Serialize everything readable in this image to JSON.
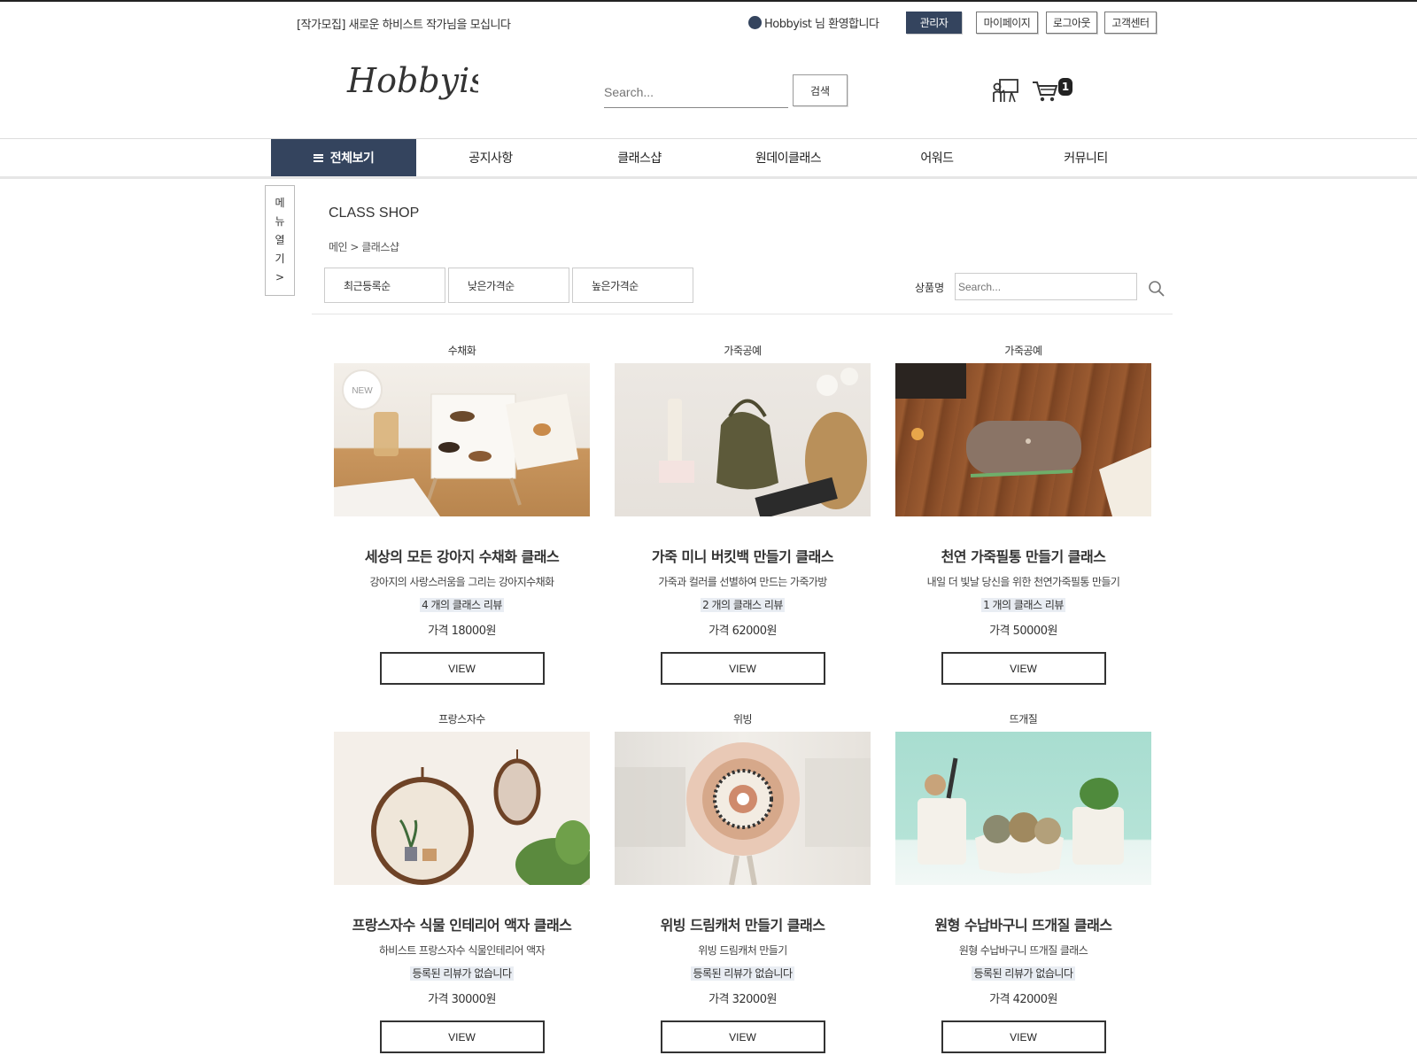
{
  "topbar": {
    "notice": "[작가모집] 새로운 하비스트 작가님을 모십니다",
    "welcome": "Hobbyist 님 환영합니다",
    "admin": "관리자",
    "mypage": "마이페이지",
    "logout": "로그아웃",
    "support": "고객센터"
  },
  "header": {
    "logo": "Hobbyist",
    "search_placeholder": "Search...",
    "search_button": "검색",
    "cart_count": "1"
  },
  "nav": {
    "all": "전체보기",
    "items": [
      "공지사항",
      "클래스샵",
      "원데이클래스",
      "어워드",
      "커뮤니티"
    ]
  },
  "side_menu": [
    "메",
    "뉴",
    "열",
    "기",
    ">"
  ],
  "page": {
    "title": "CLASS SHOP",
    "breadcrumb": "메인 > 클래스샵",
    "sorts": [
      "최근등록순",
      "낮은가격순",
      "높은가격순"
    ],
    "product_search_label": "상품명",
    "product_search_placeholder": "Search..."
  },
  "products": [
    {
      "category": "수채화",
      "title": "세상의 모든 강아지 수채화 클래스",
      "desc": "강아지의 사랑스러움을 그리는 강아지수채화",
      "reviews": "4 개의 클래스 리뷰",
      "price": "가격 18000원",
      "button": "VIEW",
      "badge": "NEW"
    },
    {
      "category": "가죽공예",
      "title": "가죽 미니 버킷백 만들기 클래스",
      "desc": "가죽과 컬러를 선별하여 만드는 가죽가방",
      "reviews": "2 개의 클래스 리뷰",
      "price": "가격 62000원",
      "button": "VIEW"
    },
    {
      "category": "가죽공예",
      "title": "천연 가죽필통 만들기 클래스",
      "desc": "내일 더 빛날 당신을 위한 천연가죽필통 만들기",
      "reviews": "1 개의 클래스 리뷰",
      "price": "가격 50000원",
      "button": "VIEW"
    },
    {
      "category": "프랑스자수",
      "title": "프랑스자수 식물 인테리어 액자 클래스",
      "desc": "하비스트 프랑스자수 식물인테리어 액자",
      "reviews": "등록된 리뷰가 없습니다",
      "price": "가격 30000원",
      "button": "VIEW"
    },
    {
      "category": "위빙",
      "title": "위빙 드림캐처 만들기 클래스",
      "desc": "위빙 드림캐처 만들기",
      "reviews": "등록된 리뷰가 없습니다",
      "price": "가격 32000원",
      "button": "VIEW"
    },
    {
      "category": "뜨개질",
      "title": "원형 수납바구니 뜨개질 클래스",
      "desc": "원형 수납바구니 뜨개질 클래스",
      "reviews": "등록된 리뷰가 없습니다",
      "price": "가격 42000원",
      "button": "VIEW"
    }
  ],
  "colors": {
    "accent": "#34445e",
    "review_bg": "#e9edf3"
  },
  "icons": [
    "class-icon",
    "cart-icon",
    "search-icon",
    "menu-icon"
  ]
}
